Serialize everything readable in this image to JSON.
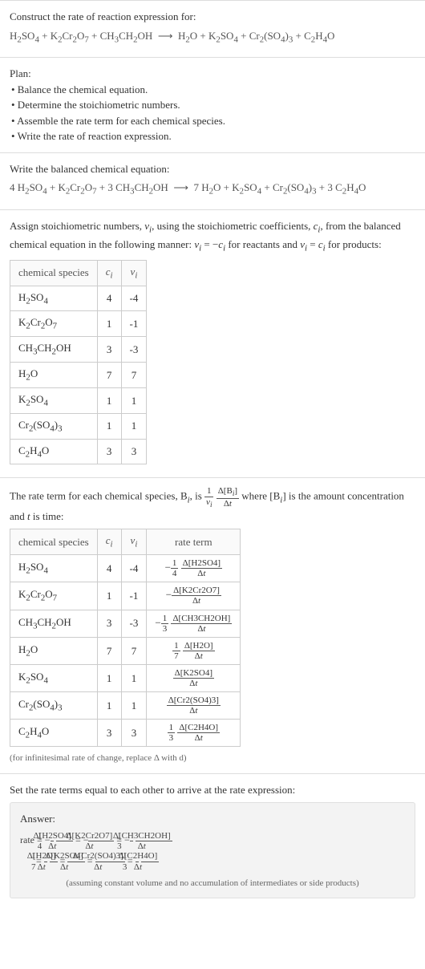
{
  "intro": {
    "prompt": "Construct the rate of reaction expression for:",
    "equation_html": "H<sub>2</sub>SO<sub>4</sub> + K<sub>2</sub>Cr<sub>2</sub>O<sub>7</sub> + CH<sub>3</sub>CH<sub>2</sub>OH &nbsp;⟶&nbsp; H<sub>2</sub>O + K<sub>2</sub>SO<sub>4</sub> + Cr<sub>2</sub>(SO<sub>4</sub>)<sub>3</sub> + C<sub>2</sub>H<sub>4</sub>O"
  },
  "plan": {
    "heading": "Plan:",
    "items": [
      "• Balance the chemical equation.",
      "• Determine the stoichiometric numbers.",
      "• Assemble the rate term for each chemical species.",
      "• Write the rate of reaction expression."
    ]
  },
  "balanced": {
    "heading": "Write the balanced chemical equation:",
    "equation_html": "4 H<sub>2</sub>SO<sub>4</sub> + K<sub>2</sub>Cr<sub>2</sub>O<sub>7</sub> + 3 CH<sub>3</sub>CH<sub>2</sub>OH &nbsp;⟶&nbsp; 7 H<sub>2</sub>O + K<sub>2</sub>SO<sub>4</sub> + Cr<sub>2</sub>(SO<sub>4</sub>)<sub>3</sub> + 3 C<sub>2</sub>H<sub>4</sub>O"
  },
  "stoich": {
    "intro_html": "Assign stoichiometric numbers, <i>ν<sub>i</sub></i>, using the stoichiometric coefficients, <i>c<sub>i</sub></i>, from the balanced chemical equation in the following manner: <i>ν<sub>i</sub></i> = −<i>c<sub>i</sub></i> for reactants and <i>ν<sub>i</sub></i> = <i>c<sub>i</sub></i> for products:",
    "headers": [
      "chemical species",
      "cᵢ",
      "νᵢ"
    ],
    "rows": [
      {
        "species_html": "H<sub>2</sub>SO<sub>4</sub>",
        "c": "4",
        "v": "-4"
      },
      {
        "species_html": "K<sub>2</sub>Cr<sub>2</sub>O<sub>7</sub>",
        "c": "1",
        "v": "-1"
      },
      {
        "species_html": "CH<sub>3</sub>CH<sub>2</sub>OH",
        "c": "3",
        "v": "-3"
      },
      {
        "species_html": "H<sub>2</sub>O",
        "c": "7",
        "v": "7"
      },
      {
        "species_html": "K<sub>2</sub>SO<sub>4</sub>",
        "c": "1",
        "v": "1"
      },
      {
        "species_html": "Cr<sub>2</sub>(SO<sub>4</sub>)<sub>3</sub>",
        "c": "1",
        "v": "1"
      },
      {
        "species_html": "C<sub>2</sub>H<sub>4</sub>O",
        "c": "3",
        "v": "3"
      }
    ]
  },
  "rate_terms": {
    "intro_html": "The rate term for each chemical species, B<sub><i>i</i></sub>, is <span class='frac'><span class='num'>1</span><span class='den'><i>ν<sub>i</sub></i></span></span> <span class='frac'><span class='num'>Δ[B<sub><i>i</i></sub>]</span><span class='den'>Δ<i>t</i></span></span> where [B<sub><i>i</i></sub>] is the amount concentration and <i>t</i> is time:",
    "headers": [
      "chemical species",
      "cᵢ",
      "νᵢ",
      "rate term"
    ],
    "rows": [
      {
        "species_html": "H<sub>2</sub>SO<sub>4</sub>",
        "c": "4",
        "v": "-4",
        "rate_html": "−<span class='frac'><span class='num'>1</span><span class='den'>4</span></span> <span class='frac'><span class='num'>Δ[H2SO4]</span><span class='den'>Δ<i>t</i></span></span>"
      },
      {
        "species_html": "K<sub>2</sub>Cr<sub>2</sub>O<sub>7</sub>",
        "c": "1",
        "v": "-1",
        "rate_html": "−<span class='frac'><span class='num'>Δ[K2Cr2O7]</span><span class='den'>Δ<i>t</i></span></span>"
      },
      {
        "species_html": "CH<sub>3</sub>CH<sub>2</sub>OH",
        "c": "3",
        "v": "-3",
        "rate_html": "−<span class='frac'><span class='num'>1</span><span class='den'>3</span></span> <span class='frac'><span class='num'>Δ[CH3CH2OH]</span><span class='den'>Δ<i>t</i></span></span>"
      },
      {
        "species_html": "H<sub>2</sub>O",
        "c": "7",
        "v": "7",
        "rate_html": "<span class='frac'><span class='num'>1</span><span class='den'>7</span></span> <span class='frac'><span class='num'>Δ[H2O]</span><span class='den'>Δ<i>t</i></span></span>"
      },
      {
        "species_html": "K<sub>2</sub>SO<sub>4</sub>",
        "c": "1",
        "v": "1",
        "rate_html": "<span class='frac'><span class='num'>Δ[K2SO4]</span><span class='den'>Δ<i>t</i></span></span>"
      },
      {
        "species_html": "Cr<sub>2</sub>(SO<sub>4</sub>)<sub>3</sub>",
        "c": "1",
        "v": "1",
        "rate_html": "<span class='frac'><span class='num'>Δ[Cr2(SO4)3]</span><span class='den'>Δ<i>t</i></span></span>"
      },
      {
        "species_html": "C<sub>2</sub>H<sub>4</sub>O",
        "c": "3",
        "v": "3",
        "rate_html": "<span class='frac'><span class='num'>1</span><span class='den'>3</span></span> <span class='frac'><span class='num'>Δ[C2H4O]</span><span class='den'>Δ<i>t</i></span></span>"
      }
    ],
    "note": "(for infinitesimal rate of change, replace Δ with d)"
  },
  "final": {
    "heading": "Set the rate terms equal to each other to arrive at the rate expression:",
    "answer_label": "Answer:",
    "line1_html": "rate = −<span class='frac'><span class='num'>1</span><span class='den'>4</span></span> <span class='frac'><span class='num'>Δ[H2SO4]</span><span class='den'>Δ<i>t</i></span></span> = −<span class='frac'><span class='num'>Δ[K2Cr2O7]</span><span class='den'>Δ<i>t</i></span></span> = −<span class='frac'><span class='num'>1</span><span class='den'>3</span></span> <span class='frac'><span class='num'>Δ[CH3CH2OH]</span><span class='den'>Δ<i>t</i></span></span>",
    "line2_html": "= <span class='frac'><span class='num'>1</span><span class='den'>7</span></span> <span class='frac'><span class='num'>Δ[H2O]</span><span class='den'>Δ<i>t</i></span></span> = <span class='frac'><span class='num'>Δ[K2SO4]</span><span class='den'>Δ<i>t</i></span></span> = <span class='frac'><span class='num'>Δ[Cr2(SO4)3]</span><span class='den'>Δ<i>t</i></span></span> = <span class='frac'><span class='num'>1</span><span class='den'>3</span></span> <span class='frac'><span class='num'>Δ[C2H4O]</span><span class='den'>Δ<i>t</i></span></span>",
    "assumption": "(assuming constant volume and no accumulation of intermediates or side products)"
  }
}
